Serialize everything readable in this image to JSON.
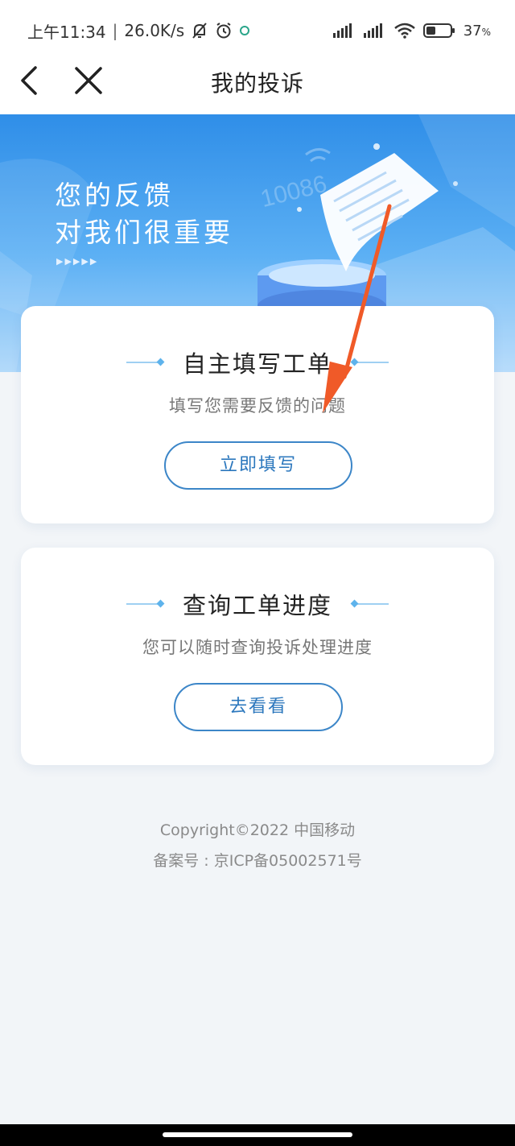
{
  "status_bar": {
    "time": "上午11:34",
    "speed": "26.0K/s",
    "battery": "37",
    "battery_unit": "%",
    "icons": [
      "mute-bell-icon",
      "alarm-icon",
      "app-notification-icon",
      "signal-icon",
      "signal-icon",
      "wifi-icon",
      "battery-icon"
    ]
  },
  "nav": {
    "title": "我的投诉",
    "back_icon": "chevron-left-icon",
    "close_icon": "close-icon"
  },
  "banner": {
    "line1": "您的反馈",
    "line2": "对我们很重要",
    "arrows": "▶▶▶▶▶",
    "watermark": "10086"
  },
  "cards": [
    {
      "title": "自主填写工单",
      "subtitle": "填写您需要反馈的问题",
      "button": "立即填写"
    },
    {
      "title": "查询工单进度",
      "subtitle": "您可以随时查询投诉处理进度",
      "button": "去看看"
    }
  ],
  "footer": {
    "copyright": "Copyright©2022 中国移动",
    "icp": "备案号 : 京ICP备05002571号"
  },
  "colors": {
    "banner_top": "#2f8ee8",
    "button_border": "#3c86c8",
    "annotation_arrow": "#f05a28",
    "page_bg": "#f2f5f8"
  }
}
